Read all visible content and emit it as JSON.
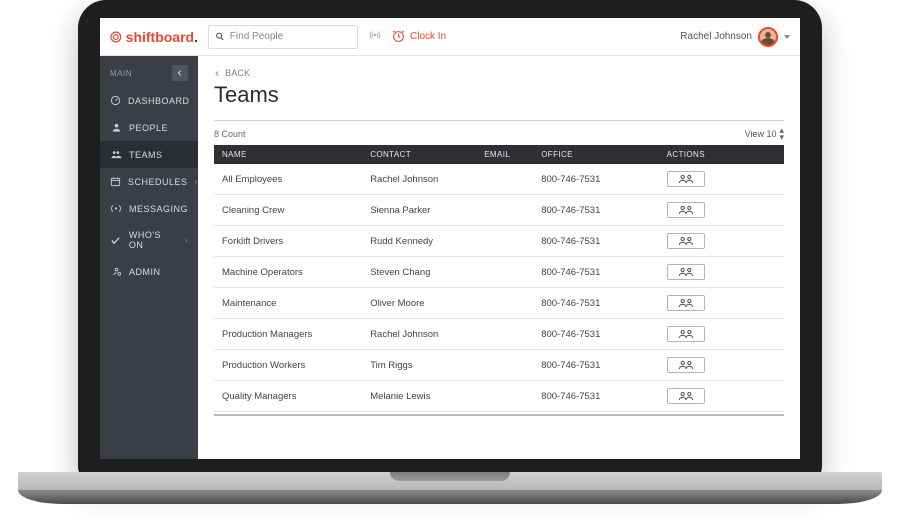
{
  "logo": {
    "text": "shiftboard"
  },
  "search": {
    "placeholder": "Find People"
  },
  "clockin": {
    "label": "Clock In"
  },
  "user": {
    "name": "Rachel Johnson"
  },
  "sidebar": {
    "section": "MAIN",
    "items": [
      {
        "label": "DASHBOARD",
        "icon": "dashboard-icon",
        "chev": false
      },
      {
        "label": "PEOPLE",
        "icon": "people-icon",
        "chev": false
      },
      {
        "label": "TEAMS",
        "icon": "teams-icon",
        "chev": false,
        "active": true
      },
      {
        "label": "SCHEDULES",
        "icon": "schedules-icon",
        "chev": true
      },
      {
        "label": "MESSAGING",
        "icon": "messaging-icon",
        "chev": false
      },
      {
        "label": "WHO'S ON",
        "icon": "whos-on-icon",
        "chev": true
      },
      {
        "label": "ADMIN",
        "icon": "admin-icon",
        "chev": false
      }
    ]
  },
  "page": {
    "back": "BACK",
    "title": "Teams",
    "count_label": "8 Count",
    "view_label": "View 10"
  },
  "columns": {
    "name": "NAME",
    "contact": "CONTACT",
    "email": "EMAIL",
    "office": "OFFICE",
    "actions": "ACTIONS"
  },
  "rows": [
    {
      "name": "All Employees",
      "contact": "Rachel Johnson",
      "email": "",
      "office": "800-746-7531"
    },
    {
      "name": "Cleaning Crew",
      "contact": "Sienna Parker",
      "email": "",
      "office": "800-746-7531"
    },
    {
      "name": "Forklift Drivers",
      "contact": "Rudd Kennedy",
      "email": "",
      "office": "800-746-7531"
    },
    {
      "name": "Machine Operators",
      "contact": "Steven Chang",
      "email": "",
      "office": "800-746-7531"
    },
    {
      "name": "Maintenance",
      "contact": "Oliver Moore",
      "email": "",
      "office": "800-746-7531"
    },
    {
      "name": "Production Managers",
      "contact": "Rachel Johnson",
      "email": "",
      "office": "800-746-7531"
    },
    {
      "name": "Production Workers",
      "contact": "Tim Riggs",
      "email": "",
      "office": "800-746-7531"
    },
    {
      "name": "Quality Managers",
      "contact": "Melanie Lewis",
      "email": "",
      "office": "800-746-7531"
    }
  ]
}
